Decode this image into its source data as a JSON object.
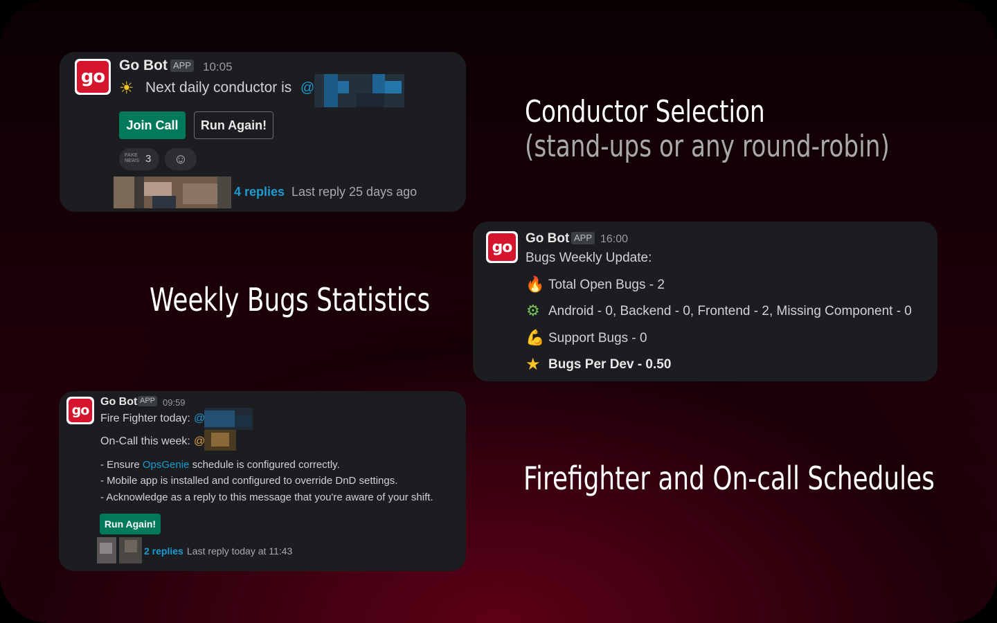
{
  "conductor_card": {
    "bot_name": "Go Bot",
    "app_badge": "APP",
    "time": "10:05",
    "message_prefix": "Next daily conductor is",
    "mention": "@",
    "join_button": "Join Call",
    "run_button": "Run Again!",
    "reaction_label": "FAKE NEWS",
    "reaction_count": "3",
    "replies": "4 replies",
    "last_reply": "Last reply 25 days ago"
  },
  "bugs_card": {
    "bot_name": "Go Bot",
    "app_badge": "APP",
    "time": "16:00",
    "heading": "Bugs Weekly Update:",
    "line1": "Total Open Bugs - 2",
    "line2": "Android - 0,  Backend - 0,  Frontend - 2,  Missing Component - 0",
    "line3": "Support Bugs - 0",
    "line4": "Bugs Per Dev - 0.50"
  },
  "firefighter_card": {
    "bot_name": "Go Bot",
    "app_badge": "APP",
    "time": "09:59",
    "fire_fighter_label": "Fire Fighter today:",
    "oncall_label": "On-Call this week:",
    "mention": "@",
    "bullet1_prefix": "- Ensure ",
    "bullet1_link": "OpsGenie",
    "bullet1_suffix": " schedule is configured correctly.",
    "bullet2": "- Mobile app is installed and configured to override DnD settings.",
    "bullet3": "- Acknowledge as a reply to this message that you're aware of your shift.",
    "run_button": "Run Again!",
    "replies": "2 replies",
    "last_reply": "Last reply today at 11:43"
  },
  "captions": {
    "conductor_title": "Conductor Selection",
    "conductor_subtitle": "(stand-ups or any round-robin)",
    "bugs_title": "Weekly Bugs Statistics",
    "firefighter_title": "Firefighter and On-call Schedules"
  },
  "logo_text": "go",
  "colors": {
    "card_bg": "#1b1d21",
    "brand_red": "#d5152b",
    "button_green": "#007a5a",
    "link_blue": "#1d9bd1",
    "caption_white": "#ffffff",
    "caption_grey": "#a9a9a9"
  }
}
